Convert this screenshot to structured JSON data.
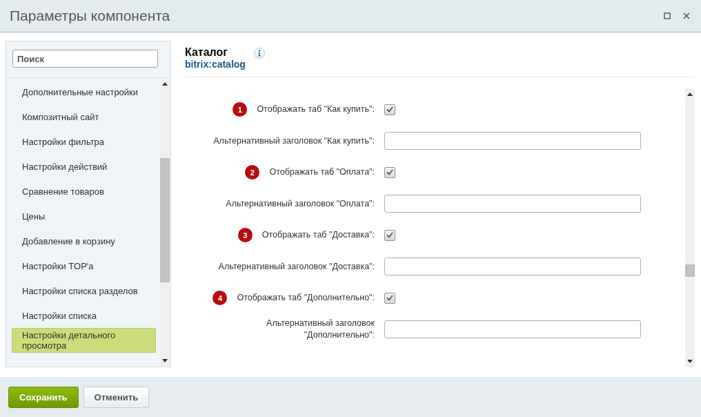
{
  "window": {
    "title": "Параметры компонента"
  },
  "search": {
    "placeholder": "Поиск"
  },
  "sidebar": {
    "items": [
      {
        "label": "Дополнительные настройки",
        "selected": false
      },
      {
        "label": "Композитный сайт",
        "selected": false
      },
      {
        "label": "Настройки фильтра",
        "selected": false
      },
      {
        "label": "Настройки действий",
        "selected": false
      },
      {
        "label": "Сравнение товаров",
        "selected": false
      },
      {
        "label": "Цены",
        "selected": false
      },
      {
        "label": "Добавление в корзину",
        "selected": false
      },
      {
        "label": "Настройки TOP'a",
        "selected": false
      },
      {
        "label": "Настройки списка разделов",
        "selected": false
      },
      {
        "label": "Настройки списка",
        "selected": false
      },
      {
        "label": "Настройки детального просмотра",
        "selected": true
      }
    ]
  },
  "component": {
    "title": "Каталог",
    "code": "bitrix:catalog"
  },
  "fields": [
    {
      "kind": "checkbox",
      "badge": "1",
      "label": "Отображать таб \"Как купить\":",
      "checked": true
    },
    {
      "kind": "text",
      "label": "Альтернативный заголовок \"Как купить\":"
    },
    {
      "kind": "checkbox",
      "badge": "2",
      "label": "Отображать таб \"Оплата\":",
      "checked": true
    },
    {
      "kind": "text",
      "label": "Альтернативный заголовок \"Оплата\":"
    },
    {
      "kind": "checkbox",
      "badge": "3",
      "label": "Отображать таб \"Доставка\":",
      "checked": true
    },
    {
      "kind": "text",
      "label": "Альтернативный заголовок \"Доставка\":"
    },
    {
      "kind": "checkbox",
      "badge": "4",
      "label": "Отображать таб \"Дополнительно\":",
      "checked": true
    },
    {
      "kind": "text",
      "label": "Альтернативный заголовок \"Дополнительно\":"
    }
  ],
  "buttons": [
    {
      "label": "Сохранить",
      "kind": "primary"
    },
    {
      "label": "Отменить",
      "kind": "secondary"
    }
  ]
}
